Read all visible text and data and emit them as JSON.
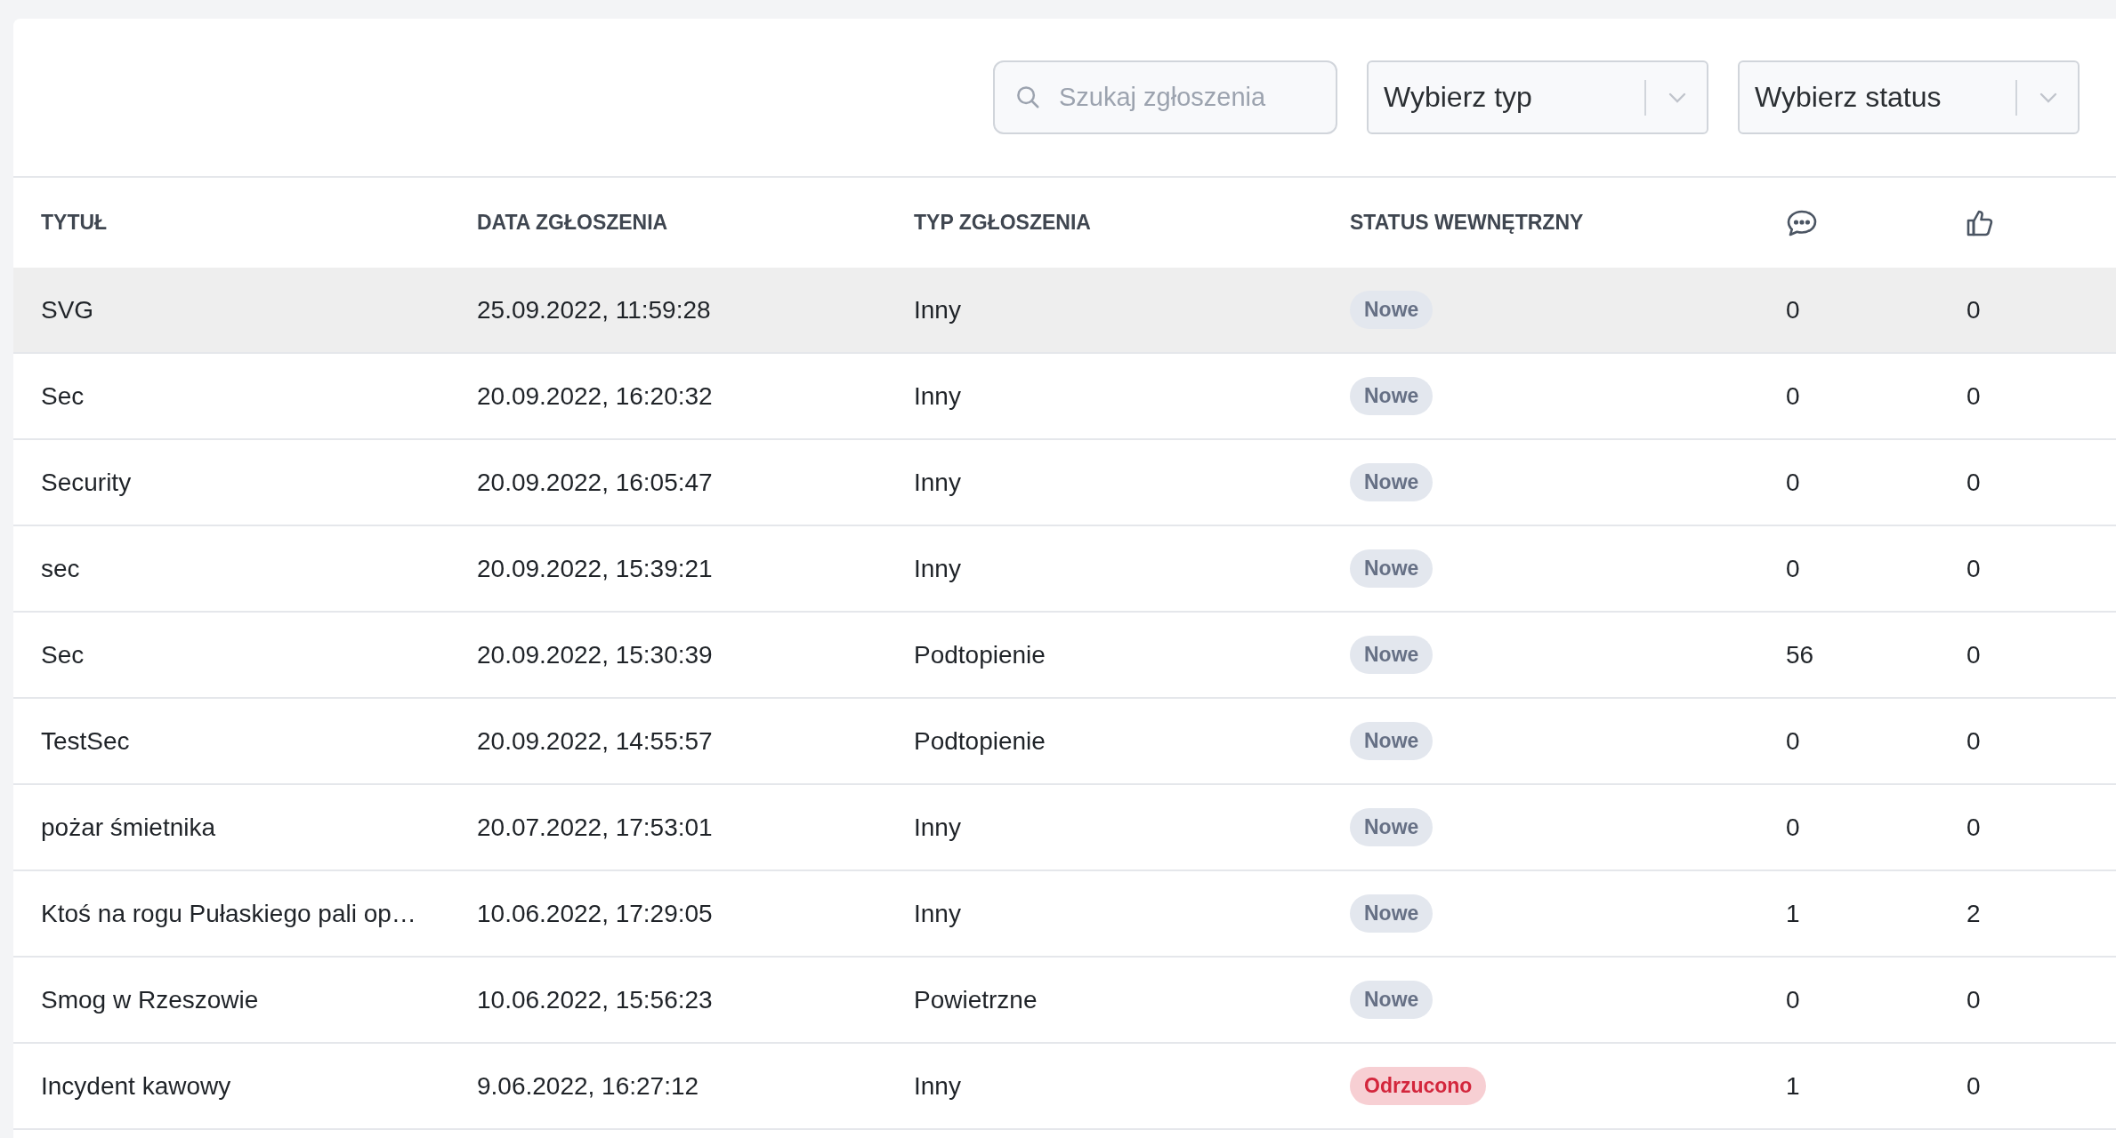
{
  "filters": {
    "search": {
      "placeholder": "Szukaj zgłoszenia"
    },
    "type_select": {
      "value": "Wybierz typ"
    },
    "status_select": {
      "value": "Wybierz status"
    }
  },
  "table": {
    "columns": [
      "TYTUŁ",
      "DATA ZGŁOSZENIA",
      "TYP ZGŁOSZENIA",
      "STATUS WEWNĘTRZNY"
    ],
    "rows": [
      {
        "title": "SVG",
        "date": "25.09.2022, 11:59:28",
        "type": "Inny",
        "status": "Nowe",
        "kind": "new",
        "comments": "0",
        "likes": "0",
        "selected": true
      },
      {
        "title": "Sec",
        "date": "20.09.2022, 16:20:32",
        "type": "Inny",
        "status": "Nowe",
        "kind": "new",
        "comments": "0",
        "likes": "0",
        "selected": false
      },
      {
        "title": "Security",
        "date": "20.09.2022, 16:05:47",
        "type": "Inny",
        "status": "Nowe",
        "kind": "new",
        "comments": "0",
        "likes": "0",
        "selected": false
      },
      {
        "title": "sec",
        "date": "20.09.2022, 15:39:21",
        "type": "Inny",
        "status": "Nowe",
        "kind": "new",
        "comments": "0",
        "likes": "0",
        "selected": false
      },
      {
        "title": "Sec",
        "date": "20.09.2022, 15:30:39",
        "type": "Podtopienie",
        "status": "Nowe",
        "kind": "new",
        "comments": "56",
        "likes": "0",
        "selected": false
      },
      {
        "title": "TestSec",
        "date": "20.09.2022, 14:55:57",
        "type": "Podtopienie",
        "status": "Nowe",
        "kind": "new",
        "comments": "0",
        "likes": "0",
        "selected": false
      },
      {
        "title": "pożar śmietnika",
        "date": "20.07.2022, 17:53:01",
        "type": "Inny",
        "status": "Nowe",
        "kind": "new",
        "comments": "0",
        "likes": "0",
        "selected": false
      },
      {
        "title": "Ktoś na rogu Pułaskiego pali op…",
        "date": "10.06.2022, 17:29:05",
        "type": "Inny",
        "status": "Nowe",
        "kind": "new",
        "comments": "1",
        "likes": "2",
        "selected": false
      },
      {
        "title": "Smog w Rzeszowie",
        "date": "10.06.2022, 15:56:23",
        "type": "Powietrzne",
        "status": "Nowe",
        "kind": "new",
        "comments": "0",
        "likes": "0",
        "selected": false
      },
      {
        "title": "Incydent kawowy",
        "date": "9.06.2022, 16:27:12",
        "type": "Inny",
        "status": "Odrzucono",
        "kind": "rejected",
        "comments": "1",
        "likes": "0",
        "selected": false
      }
    ]
  }
}
